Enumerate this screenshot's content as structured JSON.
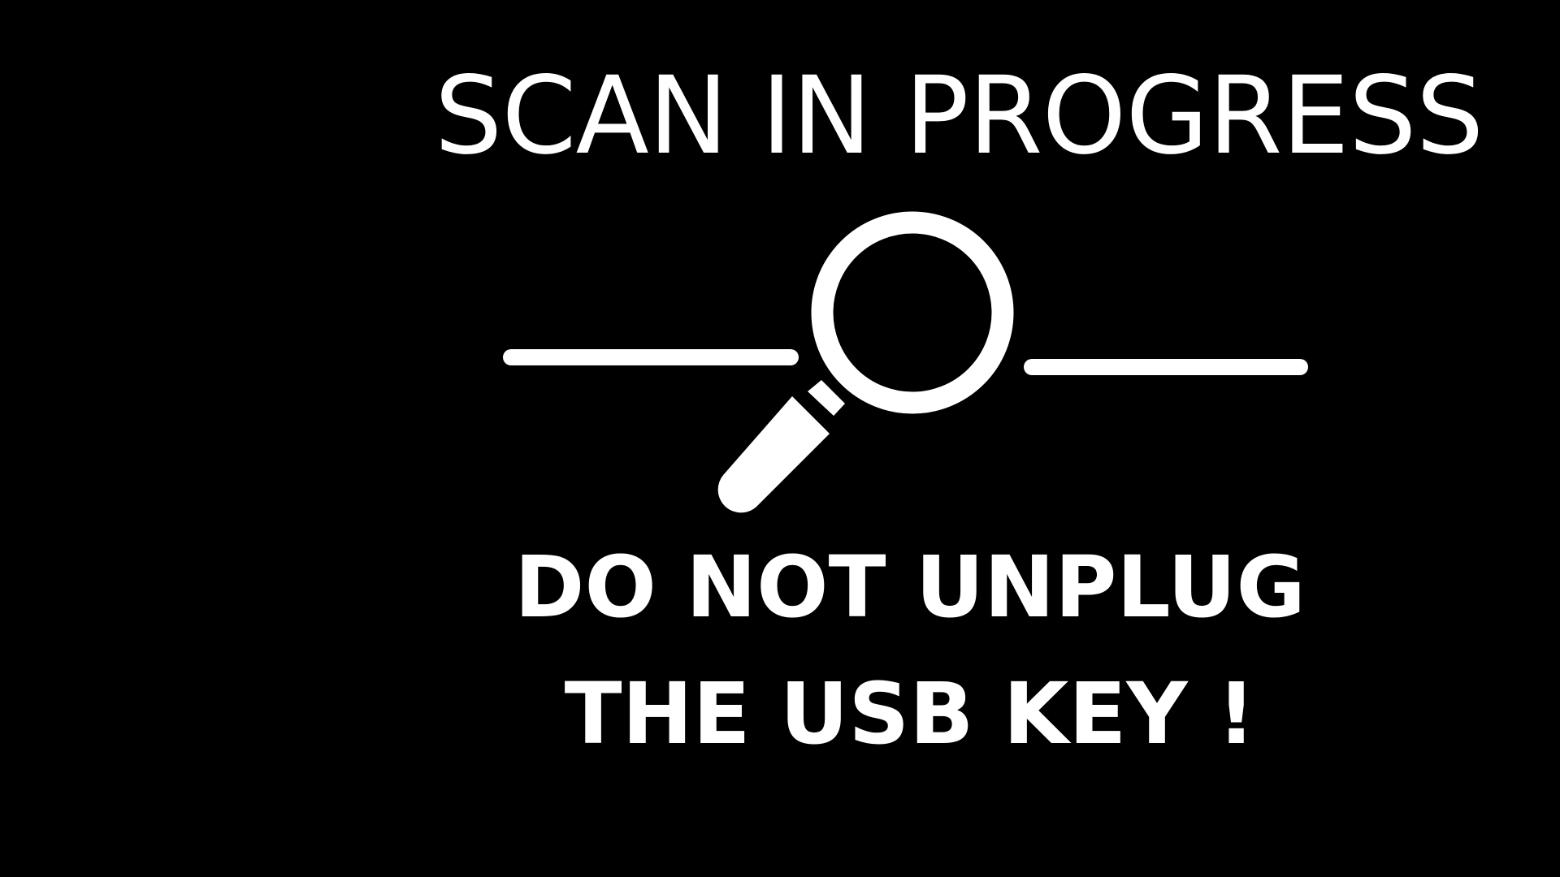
{
  "screen": {
    "title": "SCAN IN PROGRESS",
    "warning_line_1": "DO NOT UNPLUG",
    "warning_line_2": "THE USB KEY !",
    "icon": "magnifying-glass-icon",
    "background_color": "#000000",
    "foreground_color": "#ffffff"
  }
}
